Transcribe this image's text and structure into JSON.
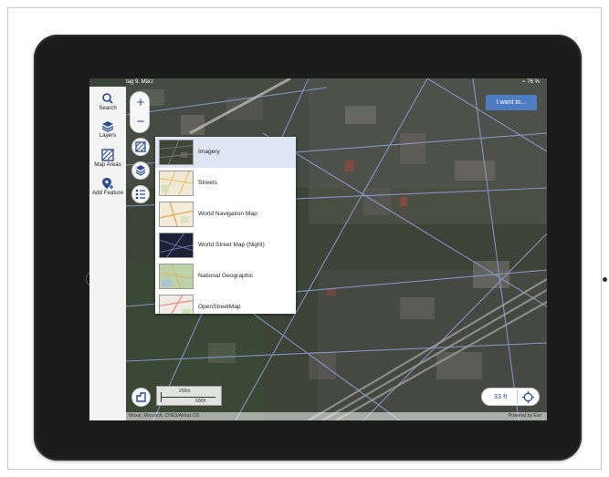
{
  "status_bar": {
    "time_date": "tag 9. März",
    "right_indicators": "⌁ 76 %"
  },
  "sidebar": {
    "items": [
      {
        "label": "Search",
        "icon": "search-icon"
      },
      {
        "label": "Layers",
        "icon": "layers-icon"
      },
      {
        "label": "Map Areas",
        "icon": "map-areas-icon"
      },
      {
        "label": "Add Feature",
        "icon": "add-feature-icon"
      }
    ]
  },
  "zoom": {
    "in_label": "+",
    "out_label": "−"
  },
  "i_want_to_label": "I want to...",
  "basemaps": [
    {
      "name": "Imagery",
      "selected": true
    },
    {
      "name": "Streets",
      "selected": false
    },
    {
      "name": "World Navigation Map",
      "selected": false
    },
    {
      "name": "World Street Map (Night)",
      "selected": false
    },
    {
      "name": "National Geographic",
      "selected": false
    },
    {
      "name": "OpenStreetMap",
      "selected": false
    }
  ],
  "scale": {
    "metric": "200m",
    "imperial": "600ft"
  },
  "distance_label": "33 ft",
  "attribution": {
    "left": "Maxar, Microsoft, CNES/Airbus DS",
    "right": "Powered by Esri"
  },
  "colors": {
    "accent": "#4e7cc3",
    "icon_blue": "#2b4f8c"
  }
}
